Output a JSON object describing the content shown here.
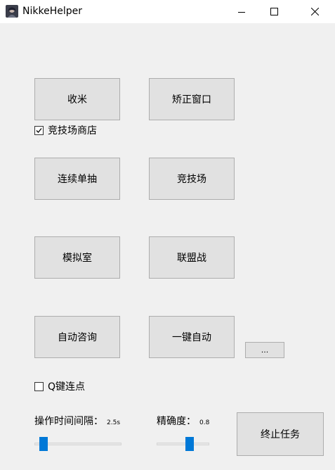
{
  "window": {
    "title": "NikkeHelper",
    "controls": {
      "minimize": "minimize-icon",
      "maximize": "maximize-icon",
      "close": "close-icon"
    }
  },
  "buttons": {
    "collect": "收米",
    "fix_window": "矫正窗口",
    "single_draw": "连续单抽",
    "arena": "竞技场",
    "simulation_room": "模拟室",
    "union_battle": "联盟战",
    "auto_consult": "自动咨询",
    "one_click_auto": "一键自动",
    "more": "...",
    "stop_task": "终止任务"
  },
  "checkboxes": {
    "arena_shop": {
      "label": "竞技场商店",
      "checked": true
    },
    "q_key_click": {
      "label": "Q键连点",
      "checked": false
    }
  },
  "sliders": {
    "interval": {
      "label": "操作时间间隔：",
      "value_text": "2.5s",
      "fraction": 0.11
    },
    "precision": {
      "label": "精确度：",
      "value_text": "0.8",
      "fraction": 0.72
    }
  },
  "colors": {
    "accent": "#0078d7",
    "button_bg": "#e1e1e1",
    "window_bg": "#f0f0f0"
  }
}
